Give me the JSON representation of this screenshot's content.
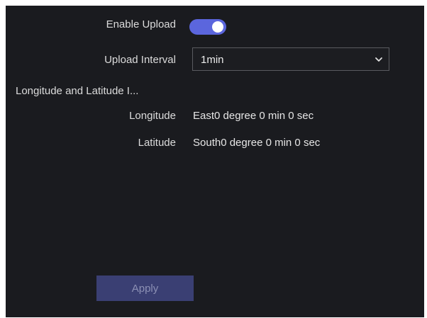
{
  "form": {
    "enable_upload": {
      "label": "Enable Upload",
      "enabled": true
    },
    "upload_interval": {
      "label": "Upload Interval",
      "value": "1min"
    },
    "lon_lat_section": {
      "label": "Longitude and Latitude I..."
    },
    "longitude": {
      "label": "Longitude",
      "value": "East0 degree 0 min 0 sec"
    },
    "latitude": {
      "label": "Latitude",
      "value": "South0 degree 0 min 0 sec"
    }
  },
  "actions": {
    "apply_label": "Apply"
  },
  "icons": {
    "dropdown": "chevron-down-icon"
  },
  "colors": {
    "background": "#1a1b1f",
    "toggle_on": "#5b66dd",
    "apply_button": "#3a3f73"
  }
}
